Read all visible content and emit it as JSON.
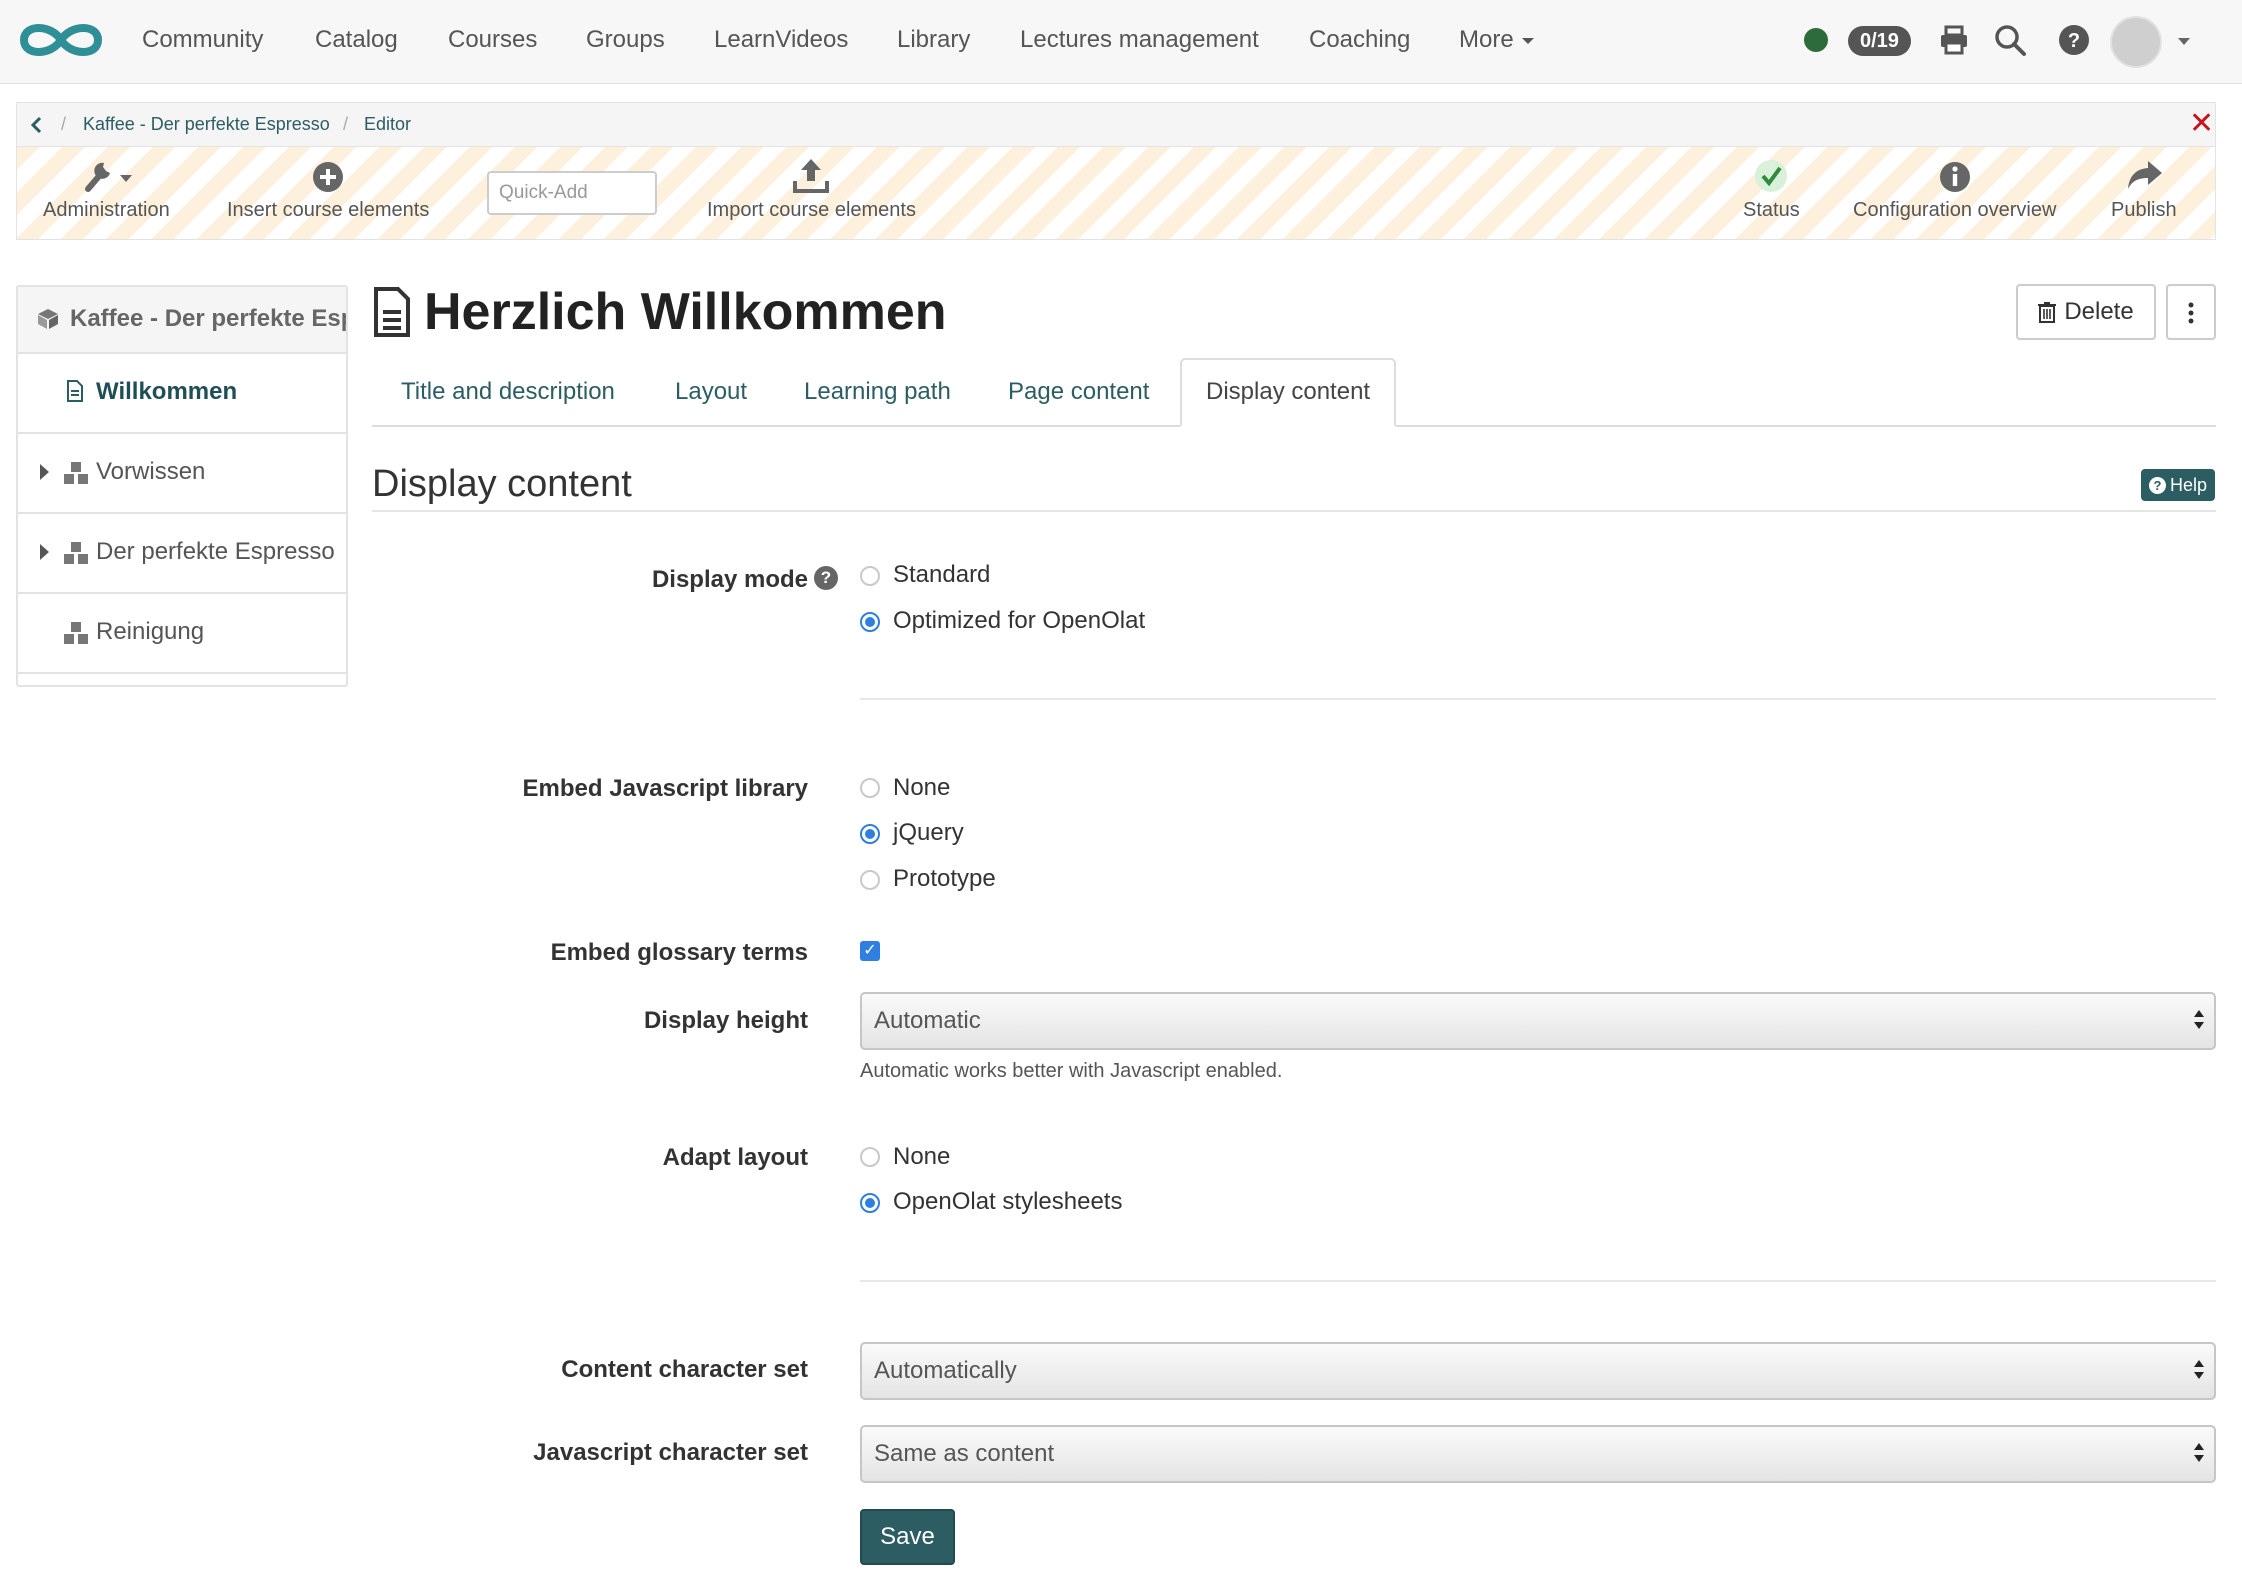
{
  "nav": {
    "items": [
      "Community",
      "Catalog",
      "Courses",
      "Groups",
      "LearnVideos",
      "Library",
      "Lectures management",
      "Coaching",
      "More"
    ],
    "progress_badge": "0/19",
    "status_color": "#2e6b3a"
  },
  "breadcrumb": {
    "course": "Kaffee - Der perfekte Espresso",
    "current": "Editor"
  },
  "toolbar": {
    "administration": "Administration",
    "insert": "Insert course elements",
    "quick_add_placeholder": "Quick-Add",
    "import": "Import course elements",
    "status": "Status",
    "config": "Configuration overview",
    "publish": "Publish"
  },
  "tree": {
    "root": "Kaffee - Der perfekte Esp",
    "items": [
      "Willkommen",
      "Vorwissen",
      "Der perfekte Espresso",
      "Reinigung"
    ]
  },
  "page": {
    "title": "Herzlich Willkommen",
    "delete_label": "Delete"
  },
  "tabs": [
    "Title and description",
    "Layout",
    "Learning path",
    "Page content",
    "Display content"
  ],
  "form": {
    "section_title": "Display content",
    "help_label": "Help",
    "display_mode": {
      "label": "Display mode",
      "options": [
        "Standard",
        "Optimized for OpenOlat"
      ],
      "selected": "Optimized for OpenOlat"
    },
    "js_library": {
      "label": "Embed Javascript library",
      "options": [
        "None",
        "jQuery",
        "Prototype"
      ],
      "selected": "jQuery"
    },
    "glossary": {
      "label": "Embed glossary terms",
      "checked": true
    },
    "display_height": {
      "label": "Display height",
      "value": "Automatic",
      "hint": "Automatic works better with Javascript enabled."
    },
    "adapt_layout": {
      "label": "Adapt layout",
      "options": [
        "None",
        "OpenOlat stylesheets"
      ],
      "selected": "OpenOlat stylesheets"
    },
    "content_charset": {
      "label": "Content character set",
      "value": "Automatically"
    },
    "js_charset": {
      "label": "Javascript character set",
      "value": "Same as content"
    },
    "save_label": "Save"
  },
  "colors": {
    "accent": "#2c5d63",
    "radio": "#2f7fe0",
    "close": "#c4151c"
  }
}
